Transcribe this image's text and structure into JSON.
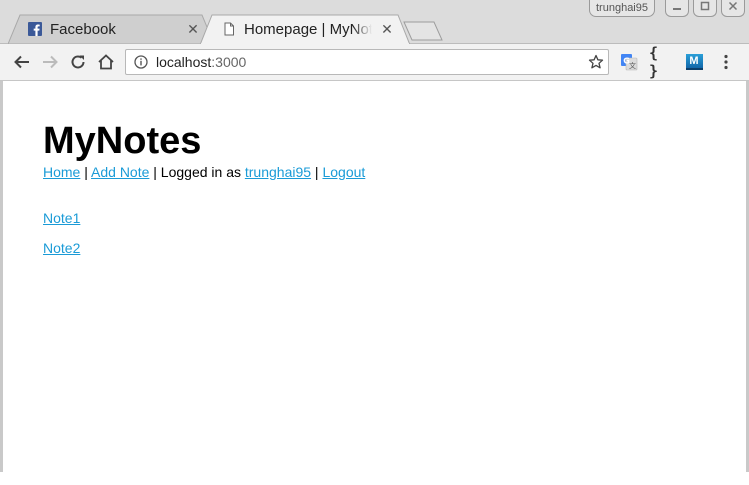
{
  "browser": {
    "tabs": [
      {
        "title": "Facebook",
        "favicon": "facebook-icon",
        "active": false
      },
      {
        "title": "Homepage | MyNote",
        "favicon": "page-icon",
        "active": true
      }
    ],
    "profile_name": "trunghai95",
    "address": {
      "host": "localhost",
      "port": ":3000"
    },
    "extensions": [
      "google-translate-icon",
      "json-viewer-icon",
      "m-extension-icon"
    ],
    "extension_m_label": "M",
    "json_label": "{ }"
  },
  "page": {
    "title": "MyNotes",
    "nav": {
      "home": "Home",
      "sep1": " | ",
      "add_note": "Add Note",
      "logged_in_text": " | Logged in as ",
      "username": "trunghai95",
      "sep2": " | ",
      "logout": "Logout"
    },
    "notes": [
      "Note1",
      "Note2"
    ]
  },
  "colors": {
    "link": "#1a9bd7",
    "facebook": "#3b5998",
    "tabstrip": "#dcdcdc",
    "toolbar": "#f2f2f2"
  }
}
